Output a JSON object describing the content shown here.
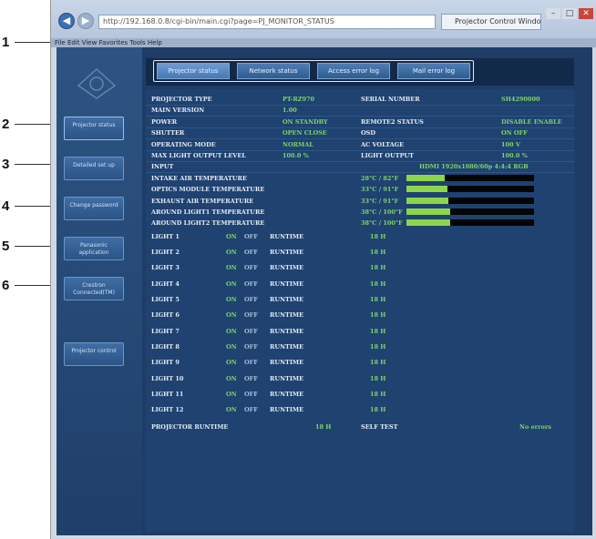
{
  "callouts": [
    "1",
    "2",
    "3",
    "4",
    "5",
    "6"
  ],
  "browser": {
    "address": "http://192.168.0.8/cgi-bin/main.cgi?page=PJ_MONITOR_STATUS",
    "tab_title": "Projector Control Window",
    "menu_text": "File  Edit  View  Favorites  Tools  Help",
    "window_controls": [
      "–",
      "□",
      "✕"
    ]
  },
  "sidebar": {
    "logo": "projector-logo",
    "buttons": [
      "Projector status",
      "Detailed set up",
      "Change password",
      "Panasonic application",
      "Crestron Connected(TM)",
      "Projector control"
    ]
  },
  "tabs": [
    "Projector status",
    "Network status",
    "Access error log",
    "Mail error log"
  ],
  "status": {
    "rows": [
      {
        "k": "PROJECTOR TYPE",
        "v": "PT-RZ970",
        "k2": "SERIAL NUMBER",
        "v2": "SH4290000"
      },
      {
        "k": "MAIN VERSION",
        "v": "1.00",
        "k2": "",
        "v2": ""
      },
      {
        "k": "POWER",
        "v": "ON  STANDBY",
        "k2": "REMOTE2 STATUS",
        "v2": "DISABLE  ENABLE"
      },
      {
        "k": "SHUTTER",
        "v": "OPEN  CLOSE",
        "k2": "OSD",
        "v2": "ON  OFF"
      },
      {
        "k": "OPERATING MODE",
        "v": "NORMAL",
        "k2": "AC VOLTAGE",
        "v2": "100 V"
      },
      {
        "k": "MAX LIGHT OUTPUT LEVEL",
        "v": "100.0 %",
        "k2": "LIGHT OUTPUT",
        "v2": "100.0 %"
      },
      {
        "k": "INPUT",
        "v": "",
        "k2": "",
        "v2": "HDMI  1920x1080/60p 4:4:4 RGB"
      }
    ],
    "temps": [
      {
        "k": "INTAKE AIR TEMPERATURE",
        "v": "28°C / 82°F",
        "level": 0.3
      },
      {
        "k": "OPTICS MODULE TEMPERATURE",
        "v": "33°C / 91°F",
        "level": 0.32
      },
      {
        "k": "EXHAUST AIR TEMPERATURE",
        "v": "33°C / 91°F",
        "level": 0.33
      },
      {
        "k": "AROUND LIGHT1 TEMPERATURE",
        "v": "38°C / 100°F",
        "level": 0.34
      },
      {
        "k": "AROUND LIGHT2 TEMPERATURE",
        "v": "38°C / 100°F",
        "level": 0.34
      }
    ],
    "lights": [
      {
        "k": "LIGHT 1",
        "on": "ON",
        "off": "OFF",
        "rt": "RUNTIME",
        "h": "18 H"
      },
      {
        "k": "LIGHT 2",
        "on": "ON",
        "off": "OFF",
        "rt": "RUNTIME",
        "h": "18 H"
      },
      {
        "k": "LIGHT 3",
        "on": "ON",
        "off": "OFF",
        "rt": "RUNTIME",
        "h": "18 H"
      },
      {
        "k": "LIGHT 4",
        "on": "ON",
        "off": "OFF",
        "rt": "RUNTIME",
        "h": "18 H"
      },
      {
        "k": "LIGHT 5",
        "on": "ON",
        "off": "OFF",
        "rt": "RUNTIME",
        "h": "18 H"
      },
      {
        "k": "LIGHT 6",
        "on": "ON",
        "off": "OFF",
        "rt": "RUNTIME",
        "h": "18 H"
      },
      {
        "k": "LIGHT 7",
        "on": "ON",
        "off": "OFF",
        "rt": "RUNTIME",
        "h": "18 H"
      },
      {
        "k": "LIGHT 8",
        "on": "ON",
        "off": "OFF",
        "rt": "RUNTIME",
        "h": "18 H"
      },
      {
        "k": "LIGHT 9",
        "on": "ON",
        "off": "OFF",
        "rt": "RUNTIME",
        "h": "18 H"
      },
      {
        "k": "LIGHT 10",
        "on": "ON",
        "off": "OFF",
        "rt": "RUNTIME",
        "h": "18 H"
      },
      {
        "k": "LIGHT 11",
        "on": "ON",
        "off": "OFF",
        "rt": "RUNTIME",
        "h": "18 H"
      },
      {
        "k": "LIGHT 12",
        "on": "ON",
        "off": "OFF",
        "rt": "RUNTIME",
        "h": "18 H"
      }
    ],
    "footer": {
      "k": "PROJECTOR RUNTIME",
      "v": "18 H",
      "k2": "SELF TEST",
      "v2": "No errors"
    }
  },
  "colors": {
    "accent_green": "#7fd36b",
    "bar_fill": "#8bd64b",
    "page_bg": "#1e3c66"
  }
}
